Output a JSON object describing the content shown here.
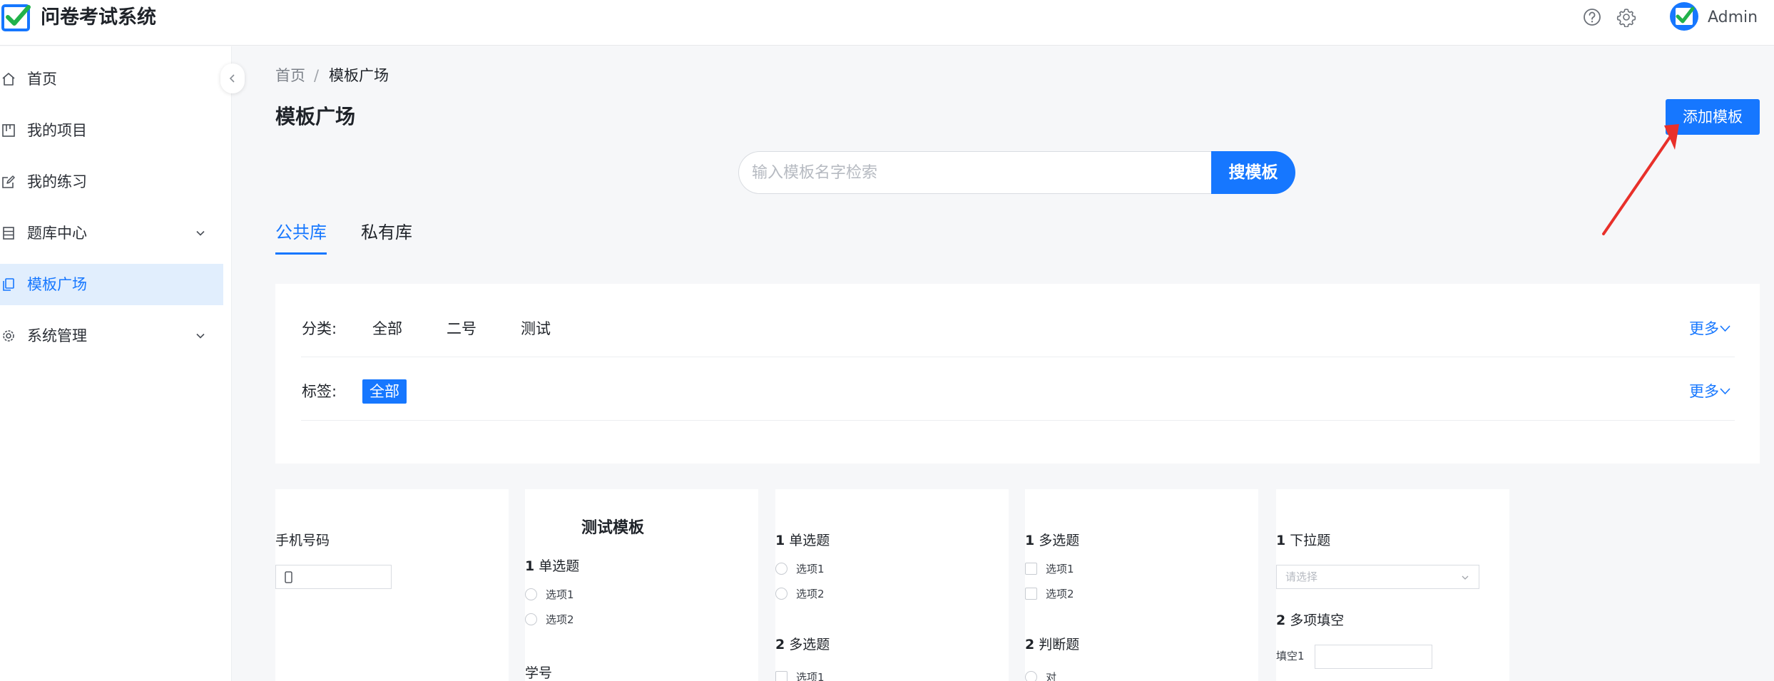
{
  "app": {
    "title": "问卷考试系统",
    "user_name": "Admin"
  },
  "header": {
    "help_icon": "help-circle-icon",
    "settings_icon": "gear-icon"
  },
  "sidebar": {
    "items": [
      {
        "label": "首页",
        "icon": "home-icon"
      },
      {
        "label": "我的项目",
        "icon": "project-icon"
      },
      {
        "label": "我的练习",
        "icon": "edit-icon"
      },
      {
        "label": "题库中心",
        "icon": "database-icon",
        "has_children": true
      },
      {
        "label": "模板广场",
        "icon": "template-icon",
        "active": true
      },
      {
        "label": "系统管理",
        "icon": "gear-icon",
        "has_children": true
      }
    ]
  },
  "breadcrumb": {
    "home": "首页",
    "separator": "/",
    "current": "模板广场"
  },
  "page": {
    "title": "模板广场",
    "add_button": "添加模板"
  },
  "search": {
    "placeholder": "输入模板名字检索",
    "value": "",
    "button": "搜模板"
  },
  "tabs": [
    {
      "label": "公共库",
      "active": true
    },
    {
      "label": "私有库",
      "active": false
    }
  ],
  "filters": {
    "category": {
      "label": "分类:",
      "options": [
        "全部",
        "二号",
        "测试"
      ],
      "more": "更多"
    },
    "tag": {
      "label": "标签:",
      "options": [
        "全部"
      ],
      "selected": "全部",
      "more": "更多"
    }
  },
  "colors": {
    "primary": "#1677ff",
    "active_bg": "#e1eefd",
    "annotation_arrow": "#e8302a"
  },
  "templates": [
    {
      "question": "手机号码"
    },
    {
      "heading": "测试模板",
      "q1": {
        "num": "1",
        "title": "单选题",
        "options": [
          "选项1",
          "选项2"
        ]
      },
      "q2": {
        "title": "学号"
      }
    },
    {
      "q1": {
        "num": "1",
        "title": "单选题",
        "options": [
          "选项1",
          "选项2"
        ]
      },
      "q2": {
        "num": "2",
        "title": "多选题",
        "options": [
          "选项1"
        ]
      }
    },
    {
      "q1": {
        "num": "1",
        "title": "多选题",
        "options": [
          "选项1",
          "选项2"
        ]
      },
      "q2": {
        "num": "2",
        "title": "判断题",
        "options": [
          "对"
        ]
      }
    },
    {
      "q1": {
        "num": "1",
        "title": "下拉题",
        "placeholder": "请选择"
      },
      "q2": {
        "num": "2",
        "title": "多项填空",
        "blank_label": "填空1"
      }
    }
  ]
}
